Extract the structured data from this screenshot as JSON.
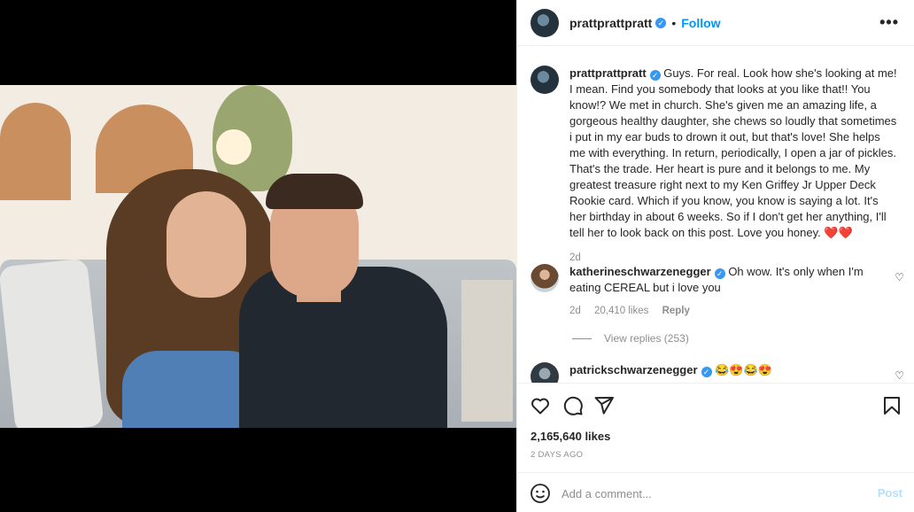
{
  "post": {
    "username": "prattprattpratt",
    "follow_label": "Follow",
    "more_label": "•••",
    "separator": "•"
  },
  "caption": {
    "username": "prattprattpratt",
    "text": "Guys. For real. Look how she's looking at me! I mean. Find you somebody that looks at you like that!! You know!? We met in church. She's given me an amazing life, a gorgeous healthy daughter, she chews so loudly that sometimes i put in my ear buds to drown it out, but that's love! She helps me with everything. In return, periodically, I open a jar of pickles. That's the trade. Her heart is pure and it belongs to me. My greatest treasure right next to my Ken Griffey Jr Upper Deck Rookie card. Which if you know, you know is saying a lot. It's her birthday in about 6 weeks. So if I don't get her anything, I'll tell her to look back on this post. Love you honey.",
    "emoji": "❤️❤️",
    "age": "2d"
  },
  "comments": [
    {
      "username": "katherineschwarzenegger",
      "text": "Oh wow. It's only when I'm eating CEREAL but i love you",
      "age": "2d",
      "likes": "20,410 likes",
      "reply_label": "Reply"
    },
    {
      "username": "patrickschwarzenegger",
      "text": "😂😍😂😍"
    }
  ],
  "view_replies": "View replies (253)",
  "likes_count": "2,165,640 likes",
  "posted_date": "2 DAYS AGO",
  "add_comment": {
    "placeholder": "Add a comment...",
    "post_label": "Post"
  },
  "icons": [
    "heart-icon",
    "comment-icon",
    "share-icon",
    "bookmark-icon",
    "smiley-icon",
    "verified-icon",
    "more-icon"
  ],
  "colors": {
    "accent": "#0095f6",
    "verified": "#3897f0",
    "post_disabled": "#b2dffc",
    "muted": "#8e8e8e"
  }
}
